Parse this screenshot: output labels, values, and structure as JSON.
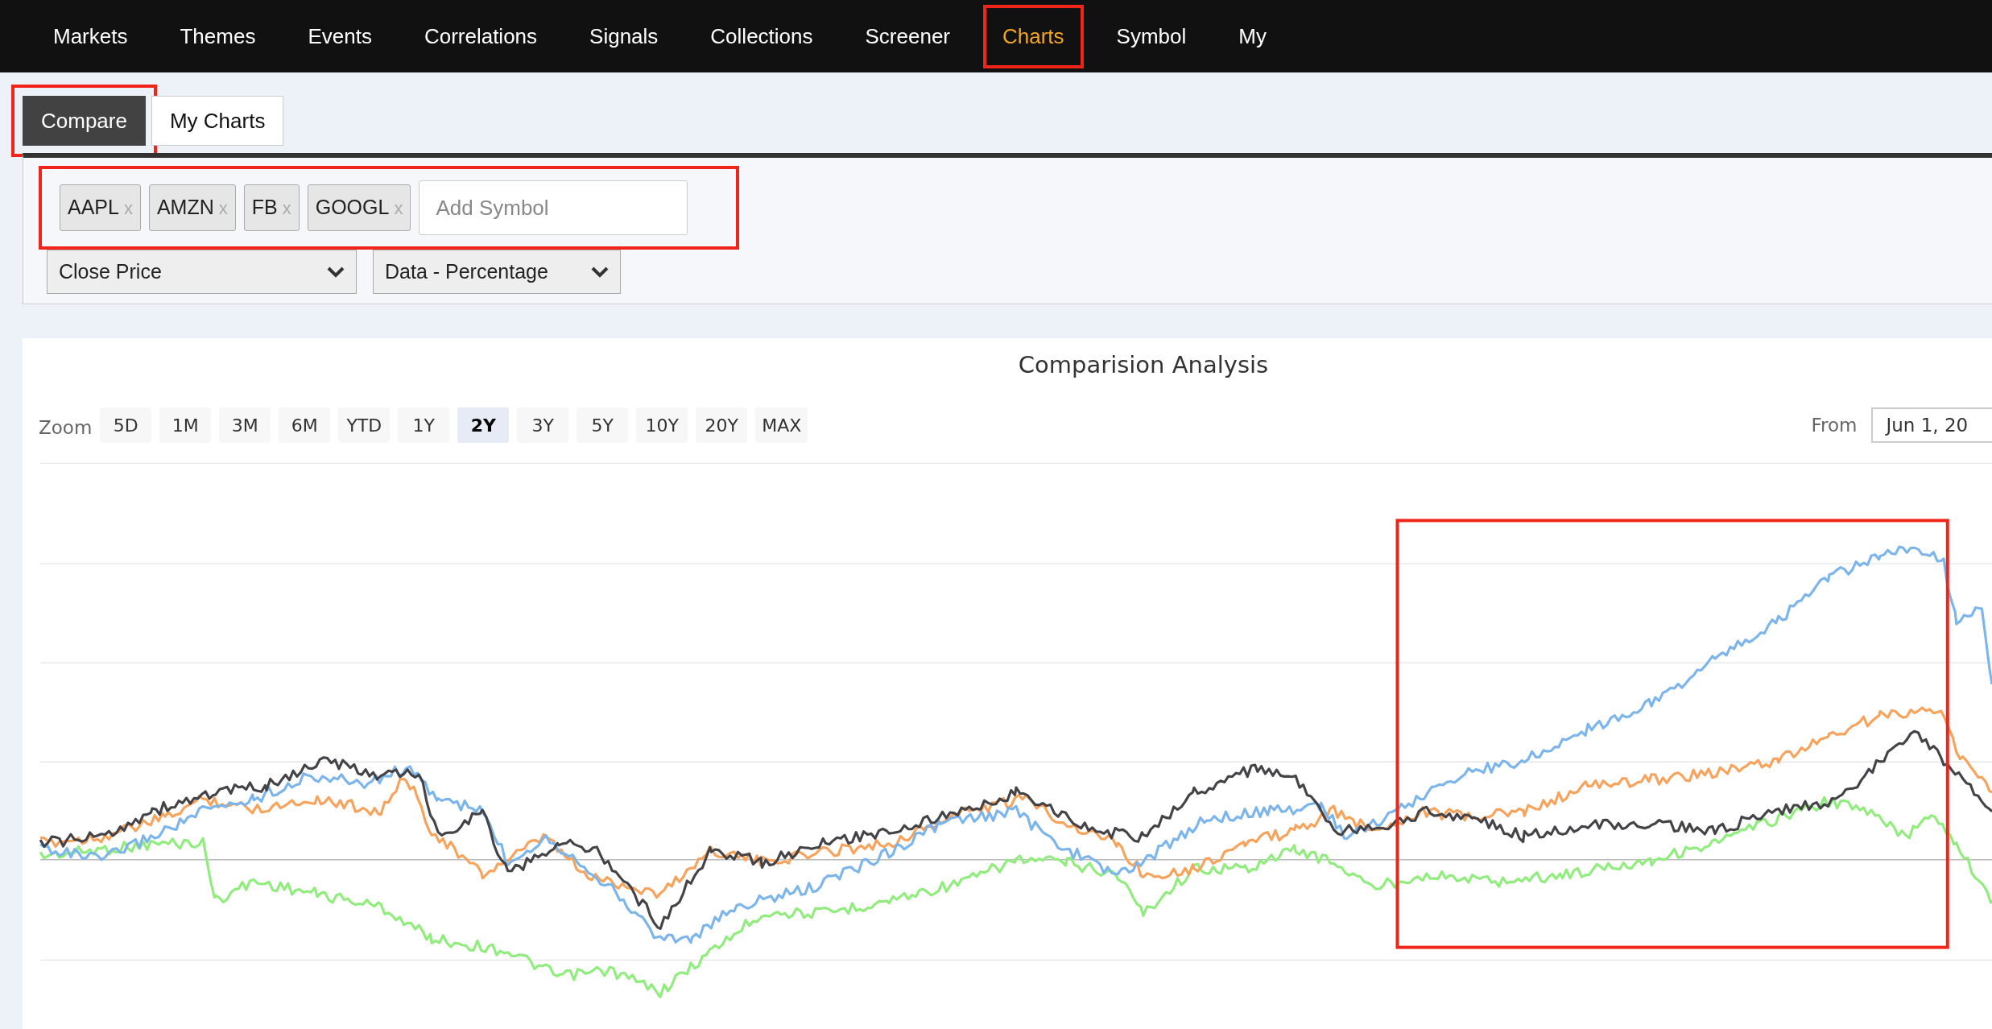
{
  "nav": [
    {
      "label": "Markets",
      "selected": false,
      "highlighted": false
    },
    {
      "label": "Themes",
      "selected": false,
      "highlighted": false
    },
    {
      "label": "Events",
      "selected": false,
      "highlighted": false
    },
    {
      "label": "Correlations",
      "selected": false,
      "highlighted": false
    },
    {
      "label": "Signals",
      "selected": false,
      "highlighted": false
    },
    {
      "label": "Collections",
      "selected": false,
      "highlighted": false
    },
    {
      "label": "Screener",
      "selected": false,
      "highlighted": false
    },
    {
      "label": "Charts",
      "selected": true,
      "highlighted": true
    },
    {
      "label": "Symbol",
      "selected": false,
      "highlighted": false
    },
    {
      "label": "My",
      "selected": false,
      "highlighted": false
    }
  ],
  "subtabs": [
    {
      "label": "Compare",
      "selected": true,
      "highlighted": true
    },
    {
      "label": "My Charts",
      "selected": false,
      "highlighted": false
    }
  ],
  "symbol_bar": {
    "highlighted": true,
    "symbols": [
      {
        "label": "AAPL",
        "remove": "x"
      },
      {
        "label": "AMZN",
        "remove": "x"
      },
      {
        "label": "FB",
        "remove": "x"
      },
      {
        "label": "GOOGL",
        "remove": "x"
      }
    ],
    "placeholder": "Add Symbol"
  },
  "selects": [
    {
      "value": "Close Price"
    },
    {
      "value": "Data - Percentage"
    }
  ],
  "chart": {
    "title": "Comparision Analysis",
    "zoom_label": "Zoom",
    "zoom_buttons": [
      {
        "label": "5D",
        "selected": false
      },
      {
        "label": "1M",
        "selected": false
      },
      {
        "label": "3M",
        "selected": false
      },
      {
        "label": "6M",
        "selected": false
      },
      {
        "label": "YTD",
        "selected": false
      },
      {
        "label": "1Y",
        "selected": false
      },
      {
        "label": "2Y",
        "selected": true
      },
      {
        "label": "3Y",
        "selected": false
      },
      {
        "label": "5Y",
        "selected": false
      },
      {
        "label": "10Y",
        "selected": false
      },
      {
        "label": "20Y",
        "selected": false
      },
      {
        "label": "MAX",
        "selected": false
      }
    ],
    "from_label": "From",
    "from_value": "Jun 1, 20",
    "highlighted": true
  }
}
